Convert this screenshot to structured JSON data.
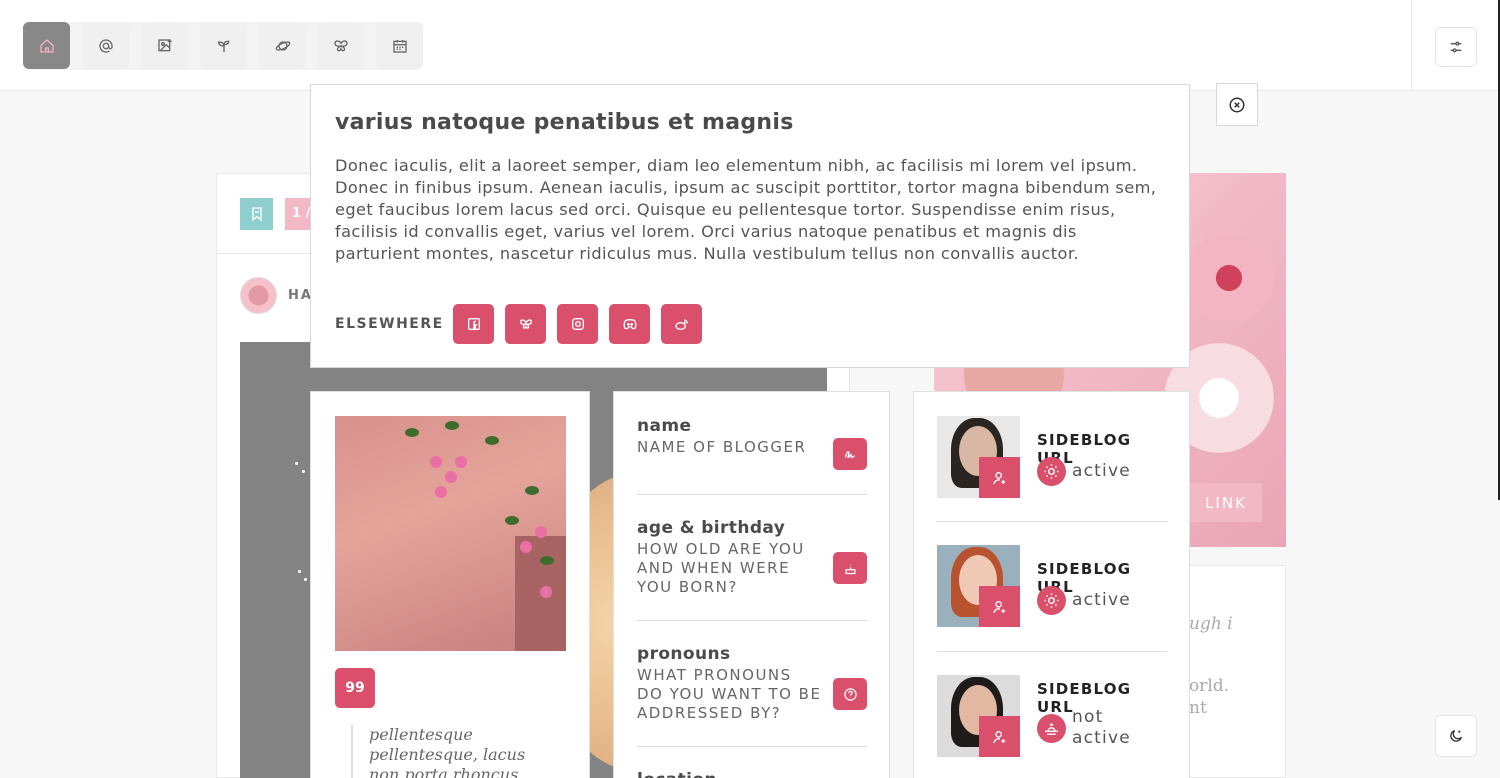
{
  "nav": {
    "items": [
      {
        "name": "home",
        "icon": "home-icon",
        "active": true
      },
      {
        "name": "mentions",
        "icon": "at-icon",
        "active": false
      },
      {
        "name": "gallery",
        "icon": "image-plus-icon",
        "active": false
      },
      {
        "name": "sprout",
        "icon": "sprout-icon",
        "active": false
      },
      {
        "name": "planet",
        "icon": "planet-icon",
        "active": false
      },
      {
        "name": "butterfly",
        "icon": "butterfly-icon",
        "active": false
      },
      {
        "name": "calendar",
        "icon": "calendar-icon",
        "active": false
      }
    ],
    "settings_icon": "sliders-icon"
  },
  "post": {
    "counter": "1 /",
    "username": "HA"
  },
  "popup": {
    "title": "varius natoque penatibus et magnis",
    "body": "Donec iaculis, elit a laoreet semper, diam leo elementum nibh, ac facilisis mi lorem vel ipsum. Donec in finibus ipsum. Aenean iaculis, ipsum ac suscipit porttitor, tortor magna bibendum sem, eget faucibus lorem lacus sed orci. Quisque eu pellentesque tortor. Suspendisse enim risus, facilisis id convallis eget, varius vel lorem. Orci varius natoque penatibus et magnis dis parturient montes, nascetur ridiculus mus. Nulla vestibulum tellus non convallis auctor.",
    "elsewhere_label": "ELSEWHERE",
    "social": [
      "facebook-icon",
      "butterfly-icon",
      "instagram-icon",
      "discord-icon",
      "weibo-icon"
    ],
    "close_icon": "close-circle-icon"
  },
  "about": {
    "quote_icon": "quote-icon",
    "quote": "pellentesque pellentesque, lacus non porta rhoncus"
  },
  "fields": [
    {
      "label": "name",
      "value": "NAME OF BLOGGER",
      "icon": "signature-icon"
    },
    {
      "label": "age & birthday",
      "value": "HOW OLD ARE YOU AND WHEN WERE YOU BORN?",
      "icon": "cake-icon"
    },
    {
      "label": "pronouns",
      "value": "WHAT PRONOUNS DO YOU WANT TO BE ADDRESSED BY?",
      "icon": "question-icon"
    },
    {
      "label": "location",
      "value": ""
    }
  ],
  "sideblogs": [
    {
      "url": "SIDEBLOG URL",
      "status": "active",
      "status_icon": "sun-icon"
    },
    {
      "url": "SIDEBLOG URL",
      "status": "active",
      "status_icon": "sun-icon"
    },
    {
      "url": "SIDEBLOG URL",
      "status": "not active",
      "status_icon": "sunset-icon"
    }
  ],
  "right": {
    "link_label": "LINK",
    "text_lines": [
      "ugh i",
      "orld.",
      "nt"
    ]
  },
  "theme_icon": "moon-icon",
  "colors": {
    "accent": "#d94f6c",
    "soft_pink": "#f2b8c6",
    "teal": "#8fcfcf"
  }
}
